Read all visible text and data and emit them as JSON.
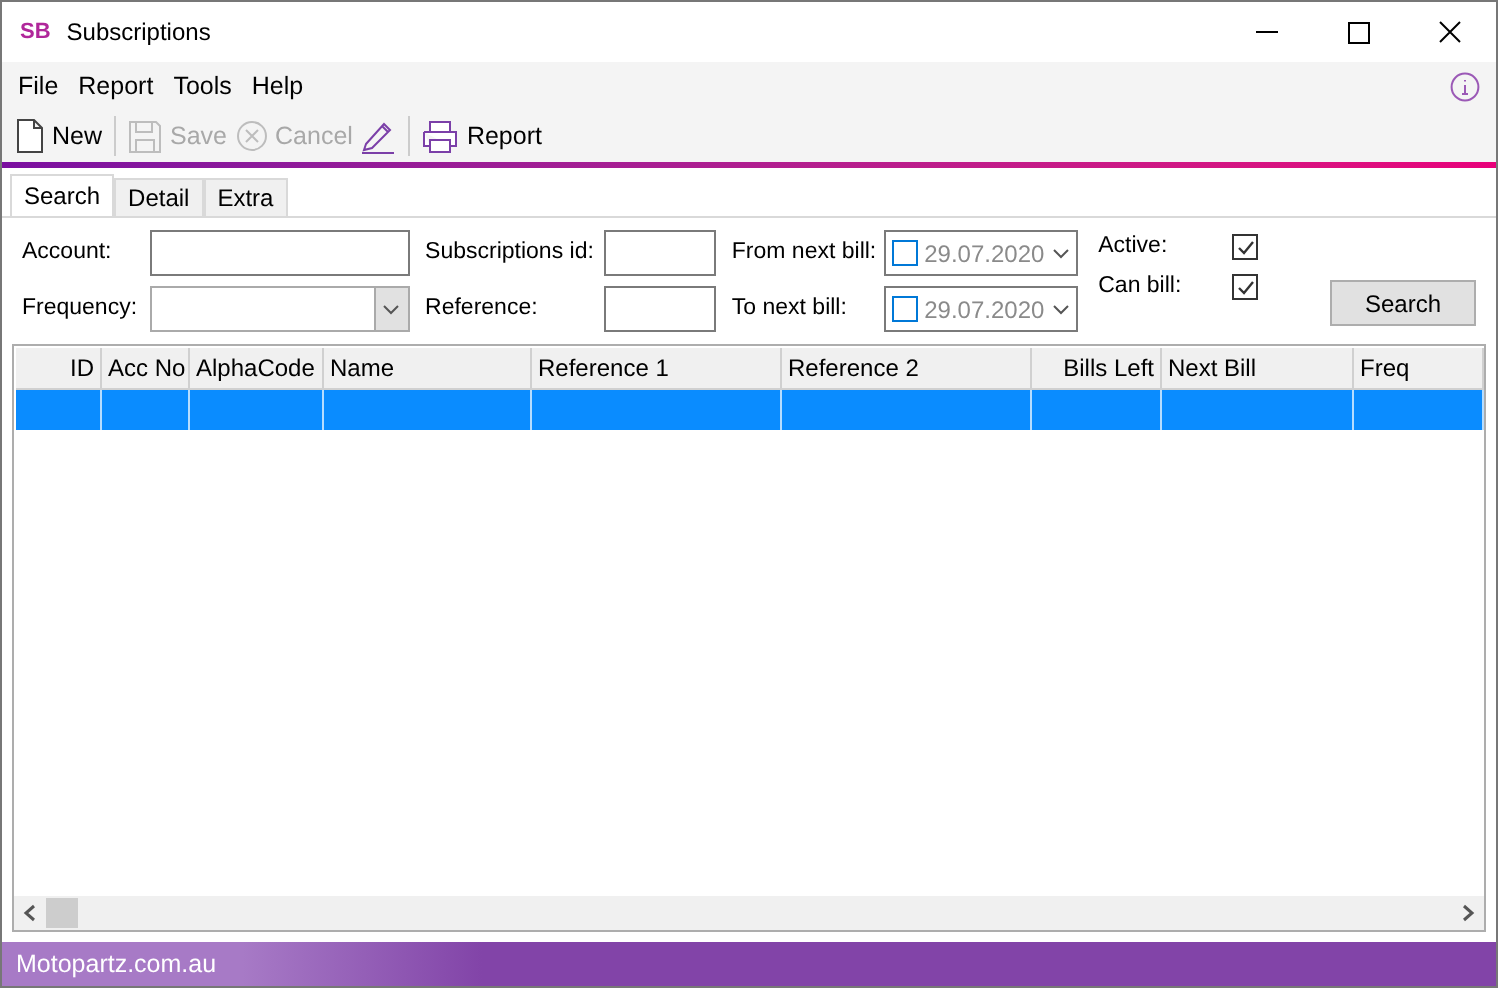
{
  "window": {
    "title": "Subscriptions",
    "logo": "SB"
  },
  "menu": [
    "File",
    "Report",
    "Tools",
    "Help"
  ],
  "toolbar": [
    {
      "kind": "new",
      "label": "New",
      "disabled": false
    },
    {
      "kind": "save",
      "label": "Save",
      "disabled": true
    },
    {
      "kind": "cancel",
      "label": "Cancel",
      "disabled": true
    },
    {
      "kind": "edit",
      "disabled": false
    },
    {
      "kind": "report",
      "label": "Report",
      "disabled": false
    }
  ],
  "tabs": [
    {
      "label": "Search",
      "selected": true
    },
    {
      "label": "Detail",
      "selected": false
    },
    {
      "label": "Extra",
      "selected": false
    }
  ],
  "form": {
    "account_label": "Account:",
    "frequency_label": "Frequency:",
    "subscriptions_id_label": "Subscriptions id:",
    "reference_label": "Reference:",
    "from_next_bill": {
      "label": "From next bill:",
      "value": "29.07.2020",
      "checked": false
    },
    "to_next_bill": {
      "label": "To next bill:",
      "value": "29.07.2020",
      "checked": false
    },
    "active": {
      "label": "Active:",
      "checked": true
    },
    "can_bill": {
      "label": "Can bill:",
      "checked": true
    },
    "search_button": "Search"
  },
  "table": {
    "columns": [
      "ID",
      "Acc No",
      "AlphaCode",
      "Name",
      "Reference 1",
      "Reference 2",
      "Bills Left",
      "Next Bill",
      "Freq"
    ],
    "rows": [
      {
        "selected": true
      }
    ]
  },
  "status_bar": "Motopartz.com.au"
}
